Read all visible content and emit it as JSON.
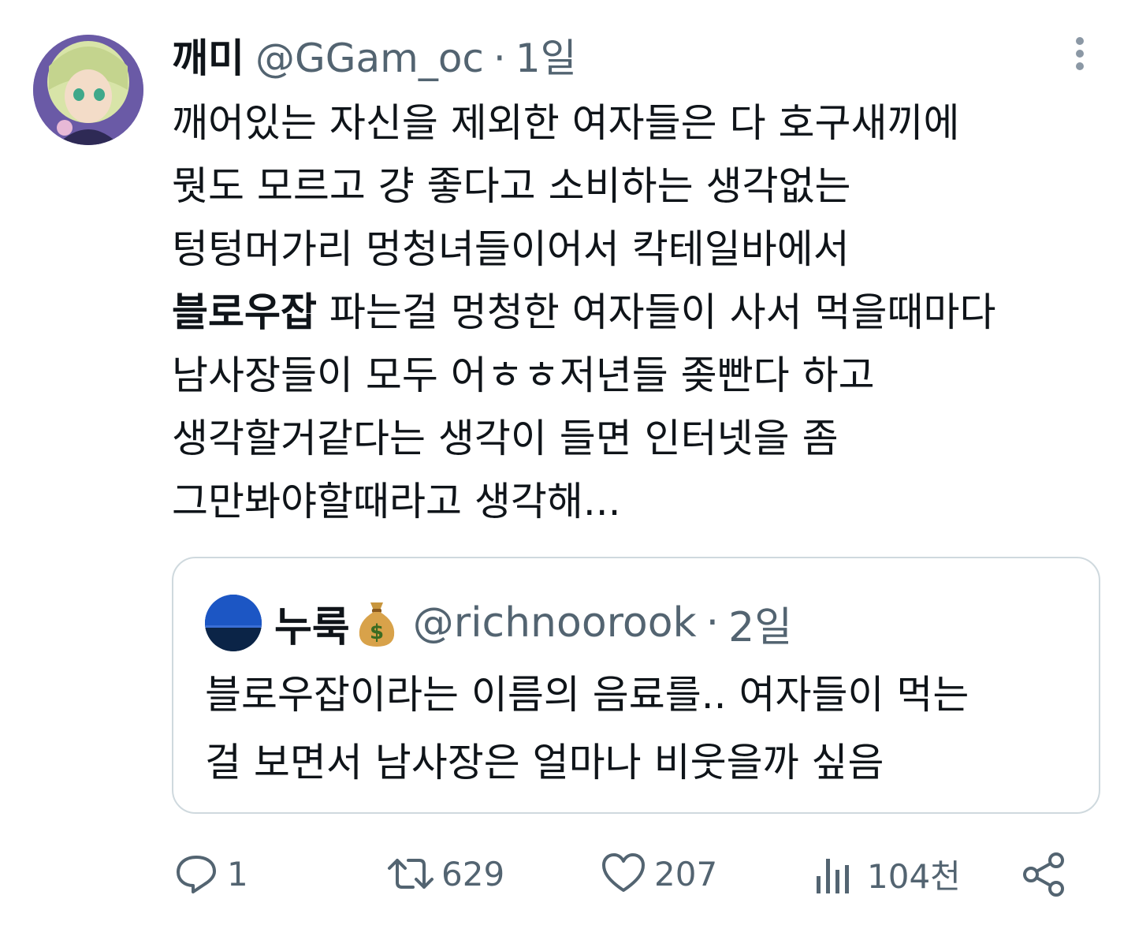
{
  "tweet": {
    "author": {
      "display_name": "깨미",
      "handle": "@GGam_oc",
      "time": "1일",
      "separator": "·"
    },
    "text_lines": [
      {
        "bold": "",
        "rest": "깨어있는 자신을 제외한 여자들은 다 호구새끼에"
      },
      {
        "bold": "",
        "rest": "뭣도 모르고 걍 좋다고 소비하는 생각없는"
      },
      {
        "bold": "",
        "rest": "텅텅머가리 멍청녀들이어서 칵테일바에서"
      },
      {
        "bold": "블로우잡",
        "rest": " 파는걸 멍청한 여자들이 사서 먹을때마다"
      },
      {
        "bold": "",
        "rest": "남사장들이 모두 어ㅎㅎ저년들 좆빤다 하고"
      },
      {
        "bold": "",
        "rest": "생각할거같다는 생각이 들면 인터넷을 좀"
      },
      {
        "bold": "",
        "rest": "그만봐야할때라고 생각해..."
      }
    ]
  },
  "quote": {
    "author": {
      "display_name": "누룩",
      "emoji_icon": "money-bag-icon",
      "handle": "@richnoorook",
      "time": "2일",
      "separator": "·"
    },
    "text_lines": [
      "블로우잡이라는 이름의 음료를.. 여자들이 먹는",
      "걸 보면서 남사장은 얼마나 비웃을까 싶음"
    ]
  },
  "actions": {
    "reply": {
      "icon": "reply-icon",
      "count": "1"
    },
    "retweet": {
      "icon": "retweet-icon",
      "count": "629"
    },
    "like": {
      "icon": "heart-icon",
      "count": "207"
    },
    "views": {
      "icon": "analytics-icon",
      "count": "104천"
    },
    "share": {
      "icon": "share-icon"
    }
  },
  "colors": {
    "text_primary": "#0f1419",
    "text_secondary": "#536471",
    "border": "#cfd9de"
  }
}
